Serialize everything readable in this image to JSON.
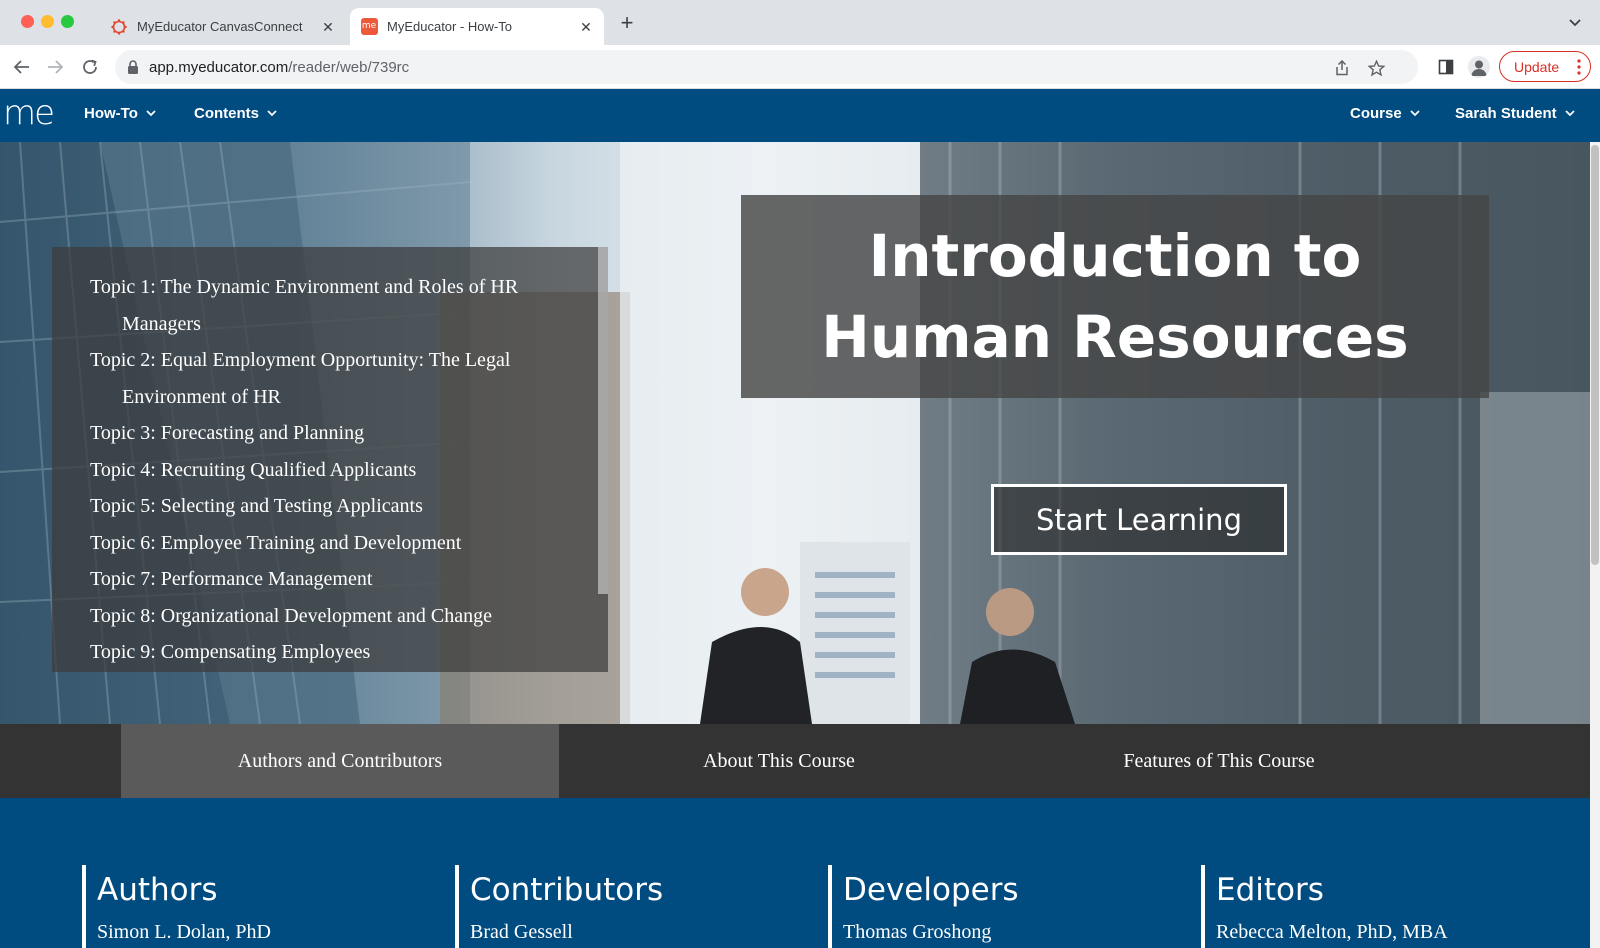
{
  "browser": {
    "tabs": [
      {
        "title": "MyEducator CanvasConnect",
        "favicon": "canvas-logo-icon"
      },
      {
        "title": "MyEducator - How-To",
        "favicon": "myeducator-logo-icon"
      }
    ],
    "url_host": "app.myeducator.com",
    "url_path": "/reader/web/739rc",
    "update_label": "Update"
  },
  "appnav": {
    "logo": "me",
    "left_items": [
      "How-To",
      "Contents"
    ],
    "right_items": [
      "Course",
      "Sarah Student"
    ]
  },
  "hero": {
    "toc": [
      "Topic 1: The Dynamic Environment and Roles of HR Managers",
      "Topic 2: Equal Employment Opportunity: The Legal Environment of HR",
      "Topic 3: Forecasting and Planning",
      "Topic 4: Recruiting Qualified Applicants",
      "Topic 5: Selecting and Testing Applicants",
      "Topic 6: Employee Training and Development",
      "Topic 7: Performance Management",
      "Topic 8: Organizational Development and Change",
      "Topic 9: Compensating Employees"
    ],
    "title_line1": "Introduction to",
    "title_line2": "Human Resources",
    "start_label": "Start Learning"
  },
  "info_tabs": [
    "Authors and Contributors",
    "About This Course",
    "Features of This Course"
  ],
  "credits": [
    {
      "heading": "Authors",
      "first": "Simon L. Dolan, PhD"
    },
    {
      "heading": "Contributors",
      "first": "Brad Gessell"
    },
    {
      "heading": "Developers",
      "first": "Thomas Groshong"
    },
    {
      "heading": "Editors",
      "first": "Rebecca Melton, PhD, MBA"
    }
  ],
  "colors": {
    "brand_blue": "#004b80",
    "update_red": "#d93025",
    "tab_bar": "#dee1e6"
  }
}
